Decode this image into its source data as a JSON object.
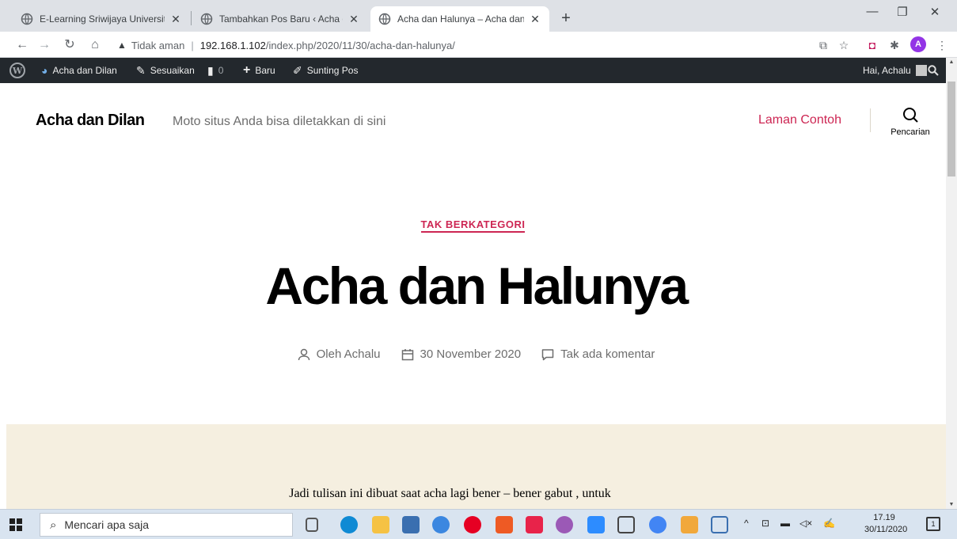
{
  "browser": {
    "tabs": [
      {
        "title": "E-Learning Sriwijaya University",
        "active": false
      },
      {
        "title": "Tambahkan Pos Baru ‹ Acha dan Dilan",
        "active": false
      },
      {
        "title": "Acha dan Halunya – Acha dan Dilan",
        "active": true
      }
    ],
    "new_tab": "+",
    "address": {
      "security_label": "Tidak aman",
      "host": "192.168.1.102",
      "path": "/index.php/2020/11/30/acha-dan-halunya/"
    },
    "profile_initial": "A"
  },
  "adminbar": {
    "site_name": "Acha dan Dilan",
    "customize": "Sesuaikan",
    "comments_count": "0",
    "new": "Baru",
    "edit_post": "Sunting Pos",
    "greeting": "Hai, Achalu"
  },
  "site": {
    "title": "Acha dan Dilan",
    "tagline": "Moto situs Anda bisa diletakkan di sini",
    "menu_link": "Laman Contoh",
    "search_label": "Pencarian"
  },
  "post": {
    "category": "TAK BERKATEGORI",
    "title": "Acha dan Halunya",
    "author": "Oleh Achalu",
    "date": "30 November 2020",
    "comments": "Tak ada komentar",
    "excerpt": "Jadi tulisan ini dibuat saat acha lagi bener – bener gabut , untuk"
  },
  "taskbar": {
    "search_placeholder": "Mencari apa saja",
    "time": "17.19",
    "date": "30/11/2020",
    "notification_count": "1"
  },
  "colors": {
    "accent": "#cd2653",
    "adminbar": "#23282d",
    "cover_bg": "#f5efe0"
  }
}
